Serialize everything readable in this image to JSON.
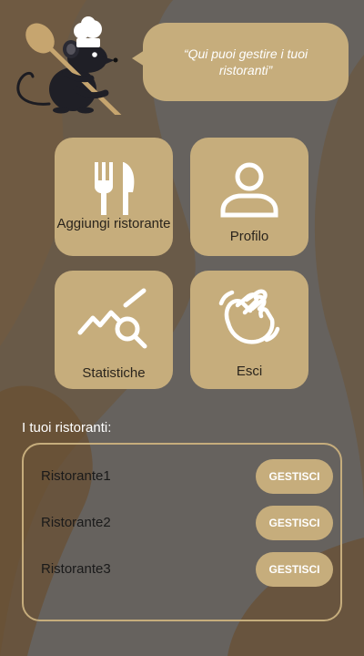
{
  "header": {
    "bubble_text": "“Qui puoi gestire i tuoi ristoranti”",
    "mascot_icon": "chef-rat-with-spoon-icon"
  },
  "tiles": [
    {
      "label": "Aggiungi ristorante",
      "icon": "fork-knife-icon"
    },
    {
      "label": "Profilo",
      "icon": "user-icon"
    },
    {
      "label": "Statistiche",
      "icon": "chart-search-icon"
    },
    {
      "label": "Esci",
      "icon": "waving-hand-icon"
    }
  ],
  "restaurants": {
    "title": "I tuoi ristoranti:",
    "items": [
      {
        "name": "Ristorante1",
        "action": "GESTISCI"
      },
      {
        "name": "Ristorante2",
        "action": "GESTISCI"
      },
      {
        "name": "Ristorante3",
        "action": "GESTISCI"
      }
    ]
  },
  "colors": {
    "accent": "#c6ad7c",
    "background": "#66625e",
    "brown": "#6b5032"
  }
}
